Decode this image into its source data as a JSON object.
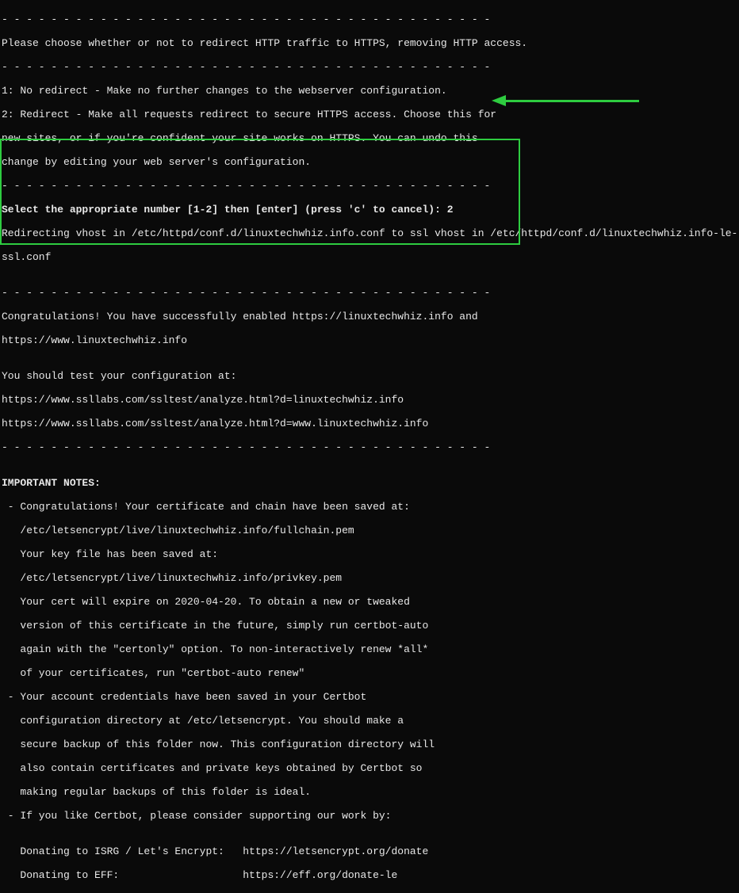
{
  "dashes1": "- - - - - - - - - - - - - - - - - - - - - - - - - - - - - - - - - - - - - - - -",
  "intro": "Please choose whether or not to redirect HTTP traffic to HTTPS, removing HTTP access.",
  "dashes2": "- - - - - - - - - - - - - - - - - - - - - - - - - - - - - - - - - - - - - - - -",
  "option1": "1: No redirect - Make no further changes to the webserver configuration.",
  "option2a": "2: Redirect - Make all requests redirect to secure HTTPS access. Choose this for",
  "option2b": "new sites, or if you're confident your site works on HTTPS. You can undo this",
  "option2c": "change by editing your web server's configuration.",
  "dashes3": "- - - - - - - - - - - - - - - - - - - - - - - - - - - - - - - - - - - - - - - -",
  "select_prompt": "Select the appropriate number [1-2] then [enter] (press 'c' to cancel): 2",
  "redirect1": "Redirecting vhost in /etc/httpd/conf.d/linuxtechwhiz.info.conf to ssl vhost in /etc/httpd/conf.d/linuxtechwhiz.info-le-",
  "redirect2": "ssl.conf",
  "blank": "",
  "dashes4": "- - - - - - - - - - - - - - - - - - - - - - - - - - - - - - - - - - - - - - - -",
  "congrats1": "Congratulations! You have successfully enabled https://linuxtechwhiz.info and",
  "congrats2": "https://www.linuxtechwhiz.info",
  "test1": "You should test your configuration at:",
  "test2": "https://www.ssllabs.com/ssltest/analyze.html?d=linuxtechwhiz.info",
  "test3": "https://www.ssllabs.com/ssltest/analyze.html?d=www.linuxtechwhiz.info",
  "dashes5": "- - - - - - - - - - - - - - - - - - - - - - - - - - - - - - - - - - - - - - - -",
  "notes_header": "IMPORTANT NOTES:",
  "n1": " - Congratulations! Your certificate and chain have been saved at:",
  "n2": "   /etc/letsencrypt/live/linuxtechwhiz.info/fullchain.pem",
  "n3": "   Your key file has been saved at:",
  "n4": "   /etc/letsencrypt/live/linuxtechwhiz.info/privkey.pem",
  "n5": "   Your cert will expire on 2020-04-20. To obtain a new or tweaked",
  "n6": "   version of this certificate in the future, simply run certbot-auto",
  "n7": "   again with the \"certonly\" option. To non-interactively renew *all*",
  "n8": "   of your certificates, run \"certbot-auto renew\"",
  "n9": " - Your account credentials have been saved in your Certbot",
  "n10": "   configuration directory at /etc/letsencrypt. You should make a",
  "n11": "   secure backup of this folder now. This configuration directory will",
  "n12": "   also contain certificates and private keys obtained by Certbot so",
  "n13": "   making regular backups of this folder is ideal.",
  "n14": " - If you like Certbot, please consider supporting our work by:",
  "d1": "   Donating to ISRG / Let's Encrypt:   https://letsencrypt.org/donate",
  "d2": "   Donating to EFF:                    https://eff.org/donate-le"
}
